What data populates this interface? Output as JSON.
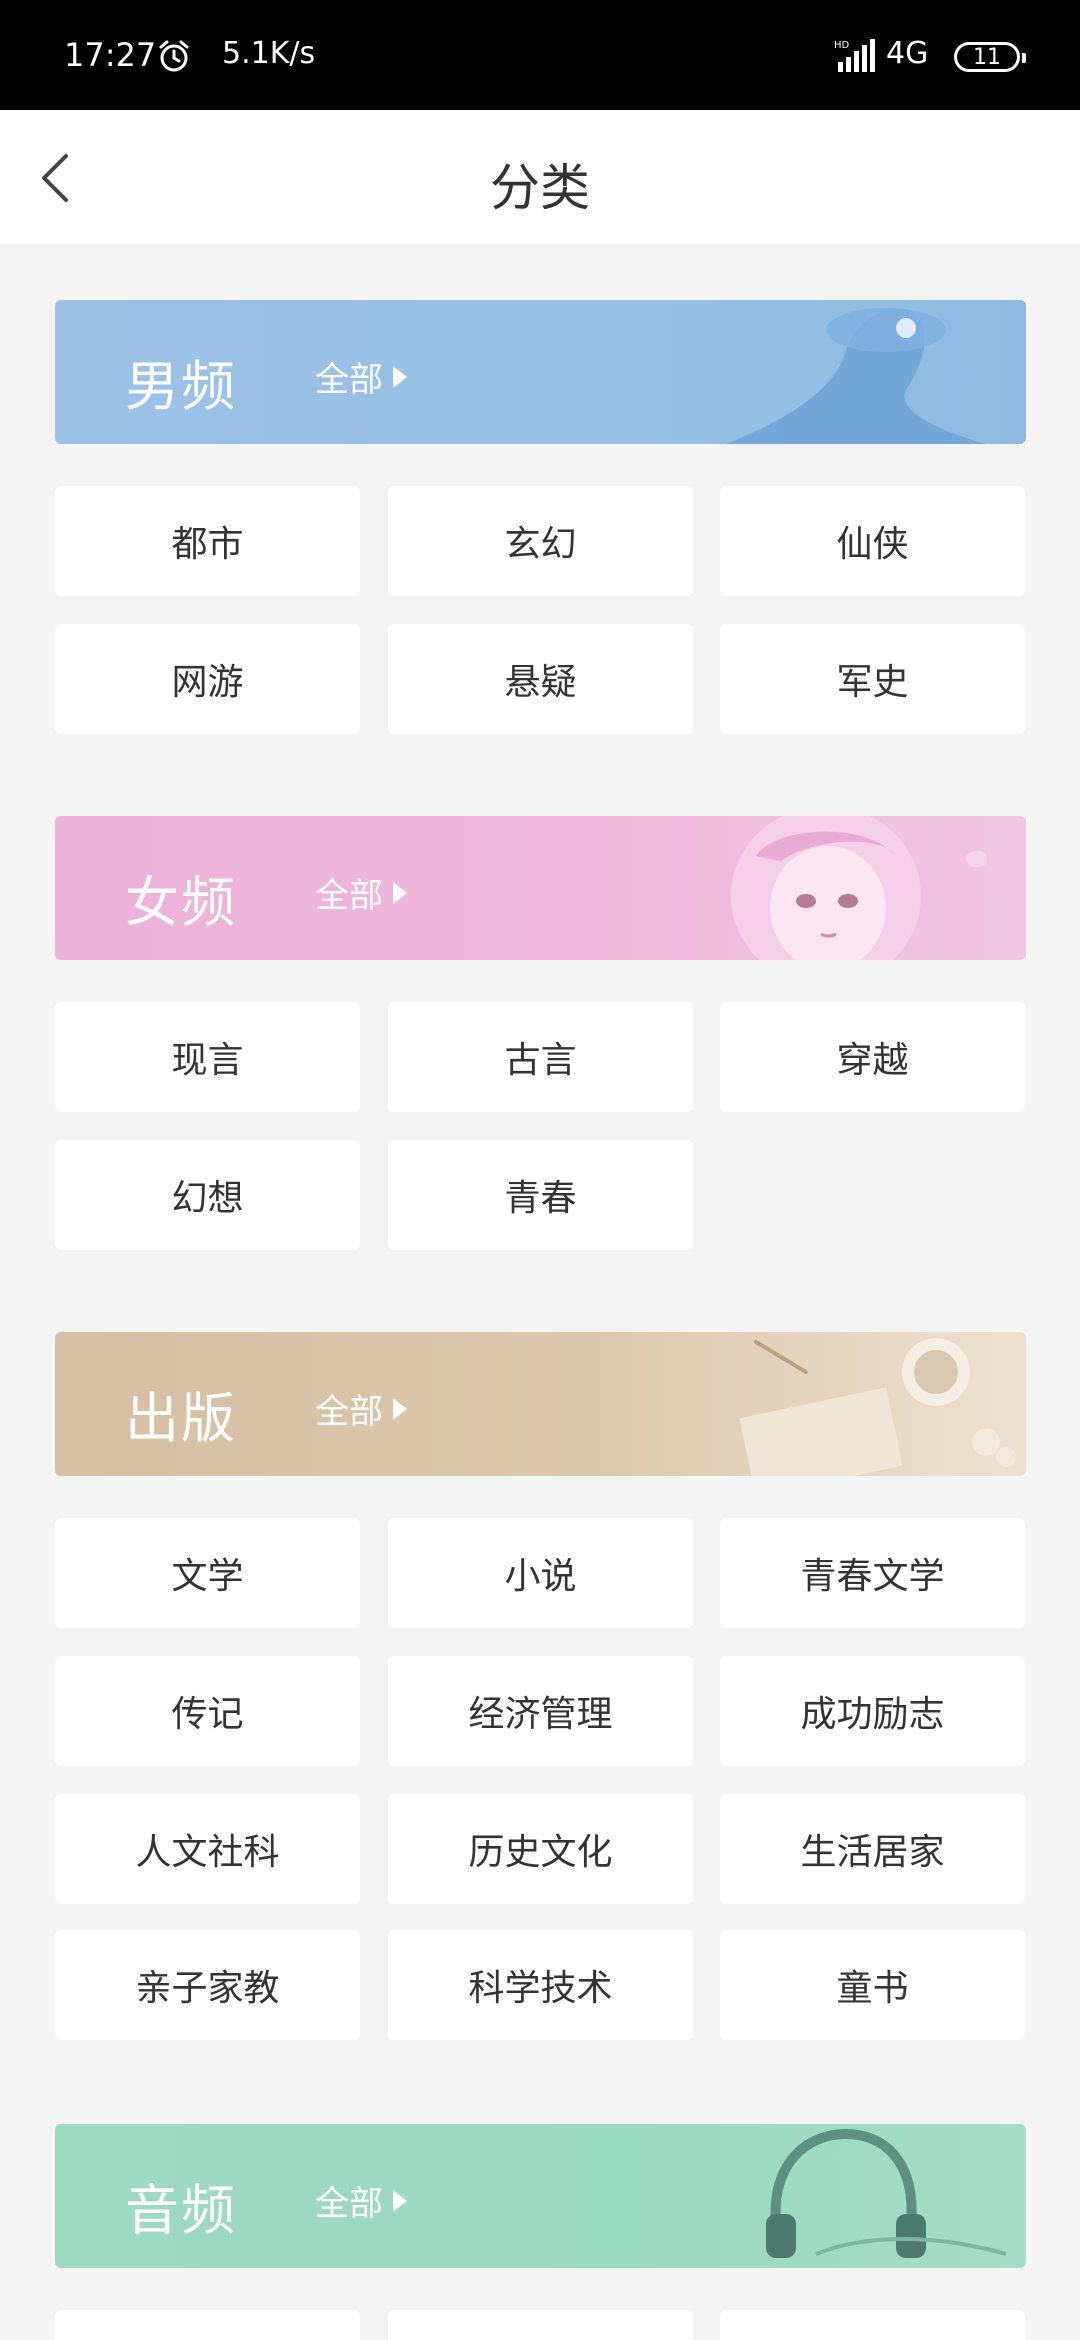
{
  "status_bar": {
    "time": "17:27",
    "speed": "5.1K/s",
    "network": "4G",
    "battery": "11"
  },
  "header": {
    "title": "分类"
  },
  "sections": {
    "male": {
      "title": "男频",
      "all_label": "全部",
      "color": "#9cc2e6",
      "tags": [
        "都市",
        "玄幻",
        "仙侠",
        "网游",
        "悬疑",
        "军史"
      ]
    },
    "female": {
      "title": "女频",
      "all_label": "全部",
      "color": "#ecb2d9",
      "tags": [
        "现言",
        "古言",
        "穿越",
        "幻想",
        "青春"
      ]
    },
    "publish": {
      "title": "出版",
      "all_label": "全部",
      "color": "#d6bfa3",
      "tags": [
        "文学",
        "小说",
        "青春文学",
        "传记",
        "经济管理",
        "成功励志",
        "人文社科",
        "历史文化",
        "生活居家",
        "亲子家教",
        "科学技术",
        "童书"
      ]
    },
    "audio": {
      "title": "音频",
      "all_label": "全部",
      "color": "#9ed9c3"
    }
  }
}
